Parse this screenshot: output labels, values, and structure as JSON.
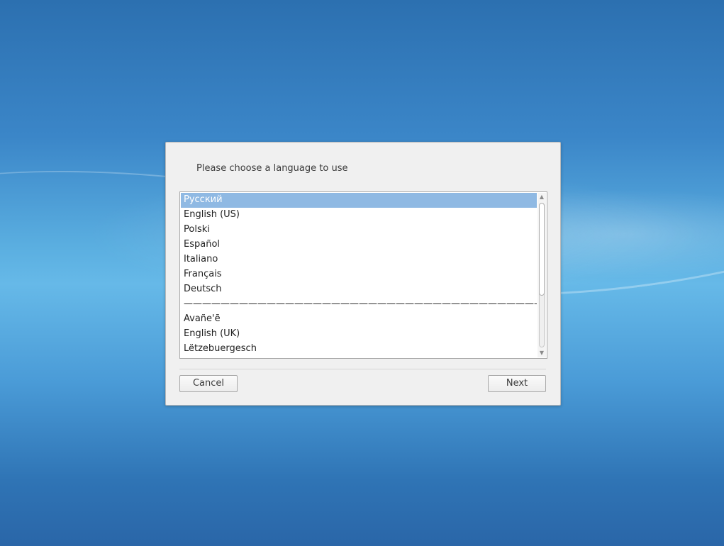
{
  "dialog": {
    "prompt": "Please choose a language to use",
    "languages": [
      {
        "label": "Русский",
        "selected": true
      },
      {
        "label": "English (US)",
        "selected": false
      },
      {
        "label": "Polski",
        "selected": false
      },
      {
        "label": "Español",
        "selected": false
      },
      {
        "label": "Italiano",
        "selected": false
      },
      {
        "label": "Français",
        "selected": false
      },
      {
        "label": "Deutsch",
        "selected": false
      },
      {
        "label": "———————————————————————————————————————",
        "selected": false
      },
      {
        "label": "Avañe'ẽ",
        "selected": false
      },
      {
        "label": "English (UK)",
        "selected": false
      },
      {
        "label": "Lëtzebuergesch",
        "selected": false
      }
    ],
    "cancel_label": "Cancel",
    "next_label": "Next"
  },
  "colors": {
    "selection": "#8fb9e3",
    "dialog_bg": "#f0f0f0",
    "desktop_blue": "#3b86c8"
  }
}
